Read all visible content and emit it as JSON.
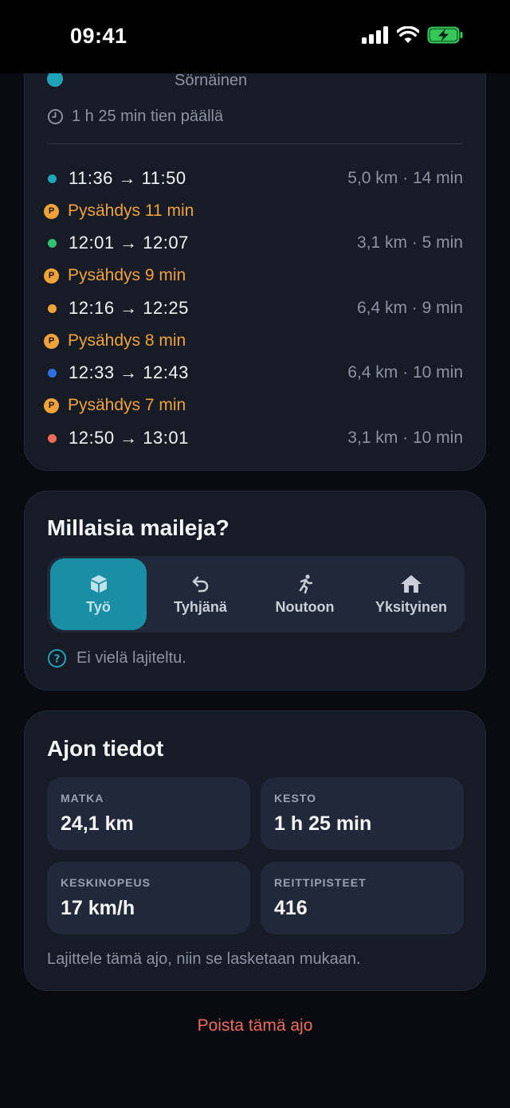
{
  "status_bar": {
    "time": "09:41"
  },
  "route": {
    "destination_name": "Sörnäinen",
    "duration_text": "1 h 25 min tien päällä",
    "segments": [
      {
        "time": "11:36 → 11:50",
        "meta": "5,0 km · 14 min",
        "color": "#1fa3b8"
      },
      {
        "time": "12:01 → 12:07",
        "meta": "3,1 km · 5 min",
        "color": "#2fc16f"
      },
      {
        "time": "12:16 → 12:25",
        "meta": "6,4 km · 9 min",
        "color": "#f0a23b"
      },
      {
        "time": "12:33 → 12:43",
        "meta": "6,4 km · 10 min",
        "color": "#2f6fe0"
      },
      {
        "time": "12:50 → 13:01",
        "meta": "3,1 km · 10 min",
        "color": "#f06a5c"
      }
    ],
    "stop_badge": "P",
    "stops": [
      "Pysähdys 11 min",
      "Pysähdys 9 min",
      "Pysähdys 8 min",
      "Pysähdys 7 min"
    ]
  },
  "trip_type": {
    "title": "Millaisia maileja?",
    "options": [
      {
        "label": "Työ",
        "icon": "box-icon",
        "selected": true
      },
      {
        "label": "Tyhjänä",
        "icon": "return-arrow-icon",
        "selected": false
      },
      {
        "label": "Noutoon",
        "icon": "running-person-icon",
        "selected": false
      },
      {
        "label": "Yksityinen",
        "icon": "house-icon",
        "selected": false
      }
    ],
    "help_text": "Ei vielä lajiteltu."
  },
  "details": {
    "title": "Ajon tiedot",
    "stats": [
      {
        "label": "MATKA",
        "value": "24,1 km"
      },
      {
        "label": "KESTO",
        "value": "1 h 25 min"
      },
      {
        "label": "KESKINOPEUS",
        "value": "17 km/h"
      },
      {
        "label": "REITTIPISTEET",
        "value": "416"
      }
    ],
    "note": "Lajittele tämä ajo, niin se lasketaan mukaan."
  },
  "delete_label": "Poista tämä ajo",
  "colors": {
    "accent": "#1a8ea4",
    "stop": "#f0a23b",
    "danger": "#ef6b5d",
    "card": "#161b25",
    "battery": "#34c759"
  }
}
